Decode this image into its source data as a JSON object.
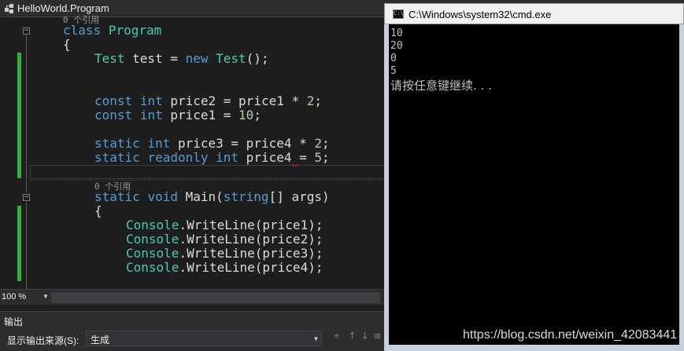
{
  "editor": {
    "nav_class": "HelloWorld.Program",
    "codelens_top": "0 个引用",
    "codelens_main": "0 个引用",
    "lines": {
      "class_decl": [
        "class",
        " ",
        "Program"
      ],
      "open_brace1": "{",
      "field_test": [
        "Test",
        " test = ",
        "new",
        " ",
        "Test",
        "();"
      ],
      "const2": [
        "const",
        " ",
        "int",
        " price2 = price1 * ",
        "2",
        ";"
      ],
      "const1": [
        "const",
        " ",
        "int",
        " price1 = ",
        "10",
        ";"
      ],
      "static3": [
        "static",
        " ",
        "int",
        " price3 = price4 * ",
        "2",
        ";"
      ],
      "static4": [
        "static",
        " ",
        "readonly",
        " ",
        "int",
        " price",
        "4",
        " = ",
        "5",
        ";"
      ],
      "main_decl": [
        "static",
        " ",
        "void",
        " Main(",
        "string",
        "[] args)"
      ],
      "open_brace2": "{",
      "w1": [
        "Console",
        ".WriteLine(price1);"
      ],
      "w2": [
        "Console",
        ".WriteLine(price2);"
      ],
      "w3": [
        "Console",
        ".WriteLine(price3);"
      ],
      "w4": [
        "Console",
        ".WriteLine(price4);"
      ]
    },
    "fold_symbol": "−"
  },
  "statusbar": {
    "zoom": "100 %"
  },
  "output": {
    "title": "输出",
    "source_label": "显示输出来源(S):",
    "source_value": "生成"
  },
  "cmd": {
    "title": "C:\\Windows\\system32\\cmd.exe",
    "icon_text": "C:\\",
    "lines": [
      "10",
      "20",
      "0",
      "5"
    ],
    "pause": "请按任意键继续. . ."
  },
  "watermark": "https://blog.csdn.net/weixin_42083441",
  "colors": {
    "keyword": "#569cd6",
    "type": "#4ec9b0",
    "number": "#b5cea8",
    "text": "#dcdcdc",
    "change_marker": "#2fb139",
    "squiggle": "#e51400"
  },
  "icons": {
    "nav": "class-icon",
    "output_tools": [
      "find-message-icon",
      "prev-message-icon",
      "next-message-icon",
      "clear-all-icon",
      "word-wrap-icon"
    ]
  }
}
